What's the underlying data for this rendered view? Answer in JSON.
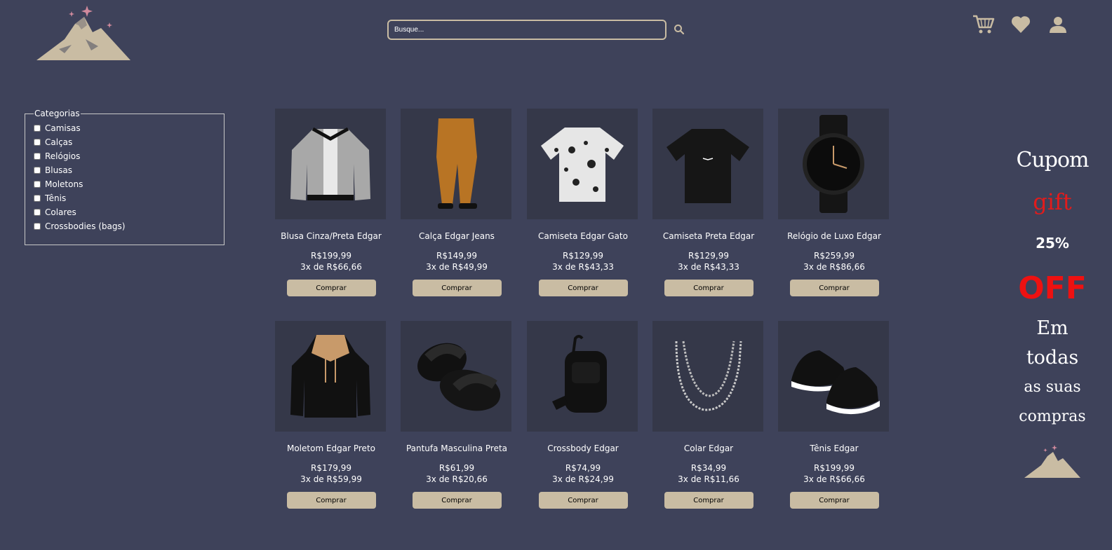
{
  "header": {
    "logo": "mountain-logo",
    "search_placeholder": "Busque...",
    "search_icon": "search-icon",
    "icons": [
      "cart-icon",
      "heart-icon",
      "user-icon"
    ]
  },
  "categories": {
    "legend": "Categorias",
    "items": [
      "Camisas",
      "Calças",
      "Relógios",
      "Blusas",
      "Moletons",
      "Tênis",
      "Colares",
      "Crossbodies (bags)"
    ]
  },
  "products": [
    {
      "name": "Blusa Cinza/Preta Edgar",
      "price": "R$199,99",
      "installments": "3x de R$66,66",
      "button": "Comprar",
      "image": "jacket-image"
    },
    {
      "name": "Calça Edgar Jeans",
      "price": "R$149,99",
      "installments": "3x de R$49,99",
      "button": "Comprar",
      "image": "pants-image"
    },
    {
      "name": "Camiseta Edgar Gato",
      "price": "R$129,99",
      "installments": "3x de R$43,33",
      "button": "Comprar",
      "image": "cat-shirt-image"
    },
    {
      "name": "Camiseta Preta Edgar",
      "price": "R$129,99",
      "installments": "3x de R$43,33",
      "button": "Comprar",
      "image": "black-tshirt-image"
    },
    {
      "name": "Relógio de Luxo Edgar",
      "price": "R$259,99",
      "installments": "3x de R$86,66",
      "button": "Comprar",
      "image": "watch-image"
    },
    {
      "name": "Moletom Edgar Preto",
      "price": "R$179,99",
      "installments": "3x de R$59,99",
      "button": "Comprar",
      "image": "hoodie-image"
    },
    {
      "name": "Pantufa Masculina Preta",
      "price": "R$61,99",
      "installments": "3x de R$20,66",
      "button": "Comprar",
      "image": "slippers-image"
    },
    {
      "name": "Crossbody Edgar",
      "price": "R$74,99",
      "installments": "3x de R$24,99",
      "button": "Comprar",
      "image": "crossbody-bag-image"
    },
    {
      "name": "Colar Edgar",
      "price": "R$34,99",
      "installments": "3x de R$11,66",
      "button": "Comprar",
      "image": "necklace-image"
    },
    {
      "name": "Tênis Edgar",
      "price": "R$199,99",
      "installments": "3x de R$66,66",
      "button": "Comprar",
      "image": "sneakers-image"
    }
  ],
  "promo": {
    "line1": "Cupom",
    "line2": "gift",
    "line3": "25%",
    "line4": "OFF",
    "line5": "Em",
    "line6": "todas",
    "line7": "as suas",
    "line8": "compras"
  },
  "colors": {
    "background": "#3e425a",
    "card_background": "#353849",
    "accent": "#c9bca3",
    "promo_red": "#e31b1b"
  }
}
